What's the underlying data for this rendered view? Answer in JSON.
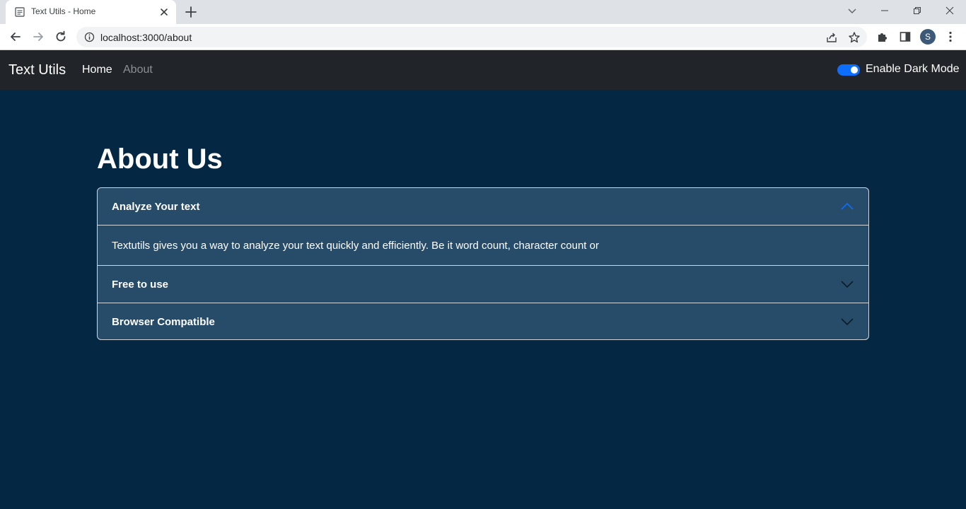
{
  "browser": {
    "tab_title": "Text Utils - Home",
    "url": "localhost:3000/about",
    "profile_initial": "S"
  },
  "navbar": {
    "brand": "Text Utils",
    "links": [
      "Home",
      "About"
    ],
    "dark_mode_label": "Enable Dark Mode",
    "dark_mode_enabled": true
  },
  "main": {
    "heading": "About Us",
    "accordion": [
      {
        "title": "Analyze Your text",
        "expanded": true,
        "body": "Textutils gives you a way to analyze your text quickly and efficiently. Be it word count, character count or"
      },
      {
        "title": "Free to use",
        "expanded": false
      },
      {
        "title": "Browser Compatible",
        "expanded": false
      }
    ]
  },
  "colors": {
    "page_background": "#042743",
    "navbar_background": "#212529",
    "accordion_background": "#274c6a",
    "switch_accent": "#0d6efd",
    "expanded_chevron": "#0d6efd"
  },
  "icons": [
    "page-favicon-icon",
    "close-icon",
    "plus-icon",
    "chevron-down-icon",
    "minimize-icon",
    "restore-icon",
    "close-window-icon",
    "back-arrow-icon",
    "forward-arrow-icon",
    "reload-icon",
    "info-icon",
    "share-icon",
    "star-icon",
    "puzzle-icon",
    "sidepanel-icon",
    "kebab-menu-icon",
    "chevron-up-icon"
  ]
}
